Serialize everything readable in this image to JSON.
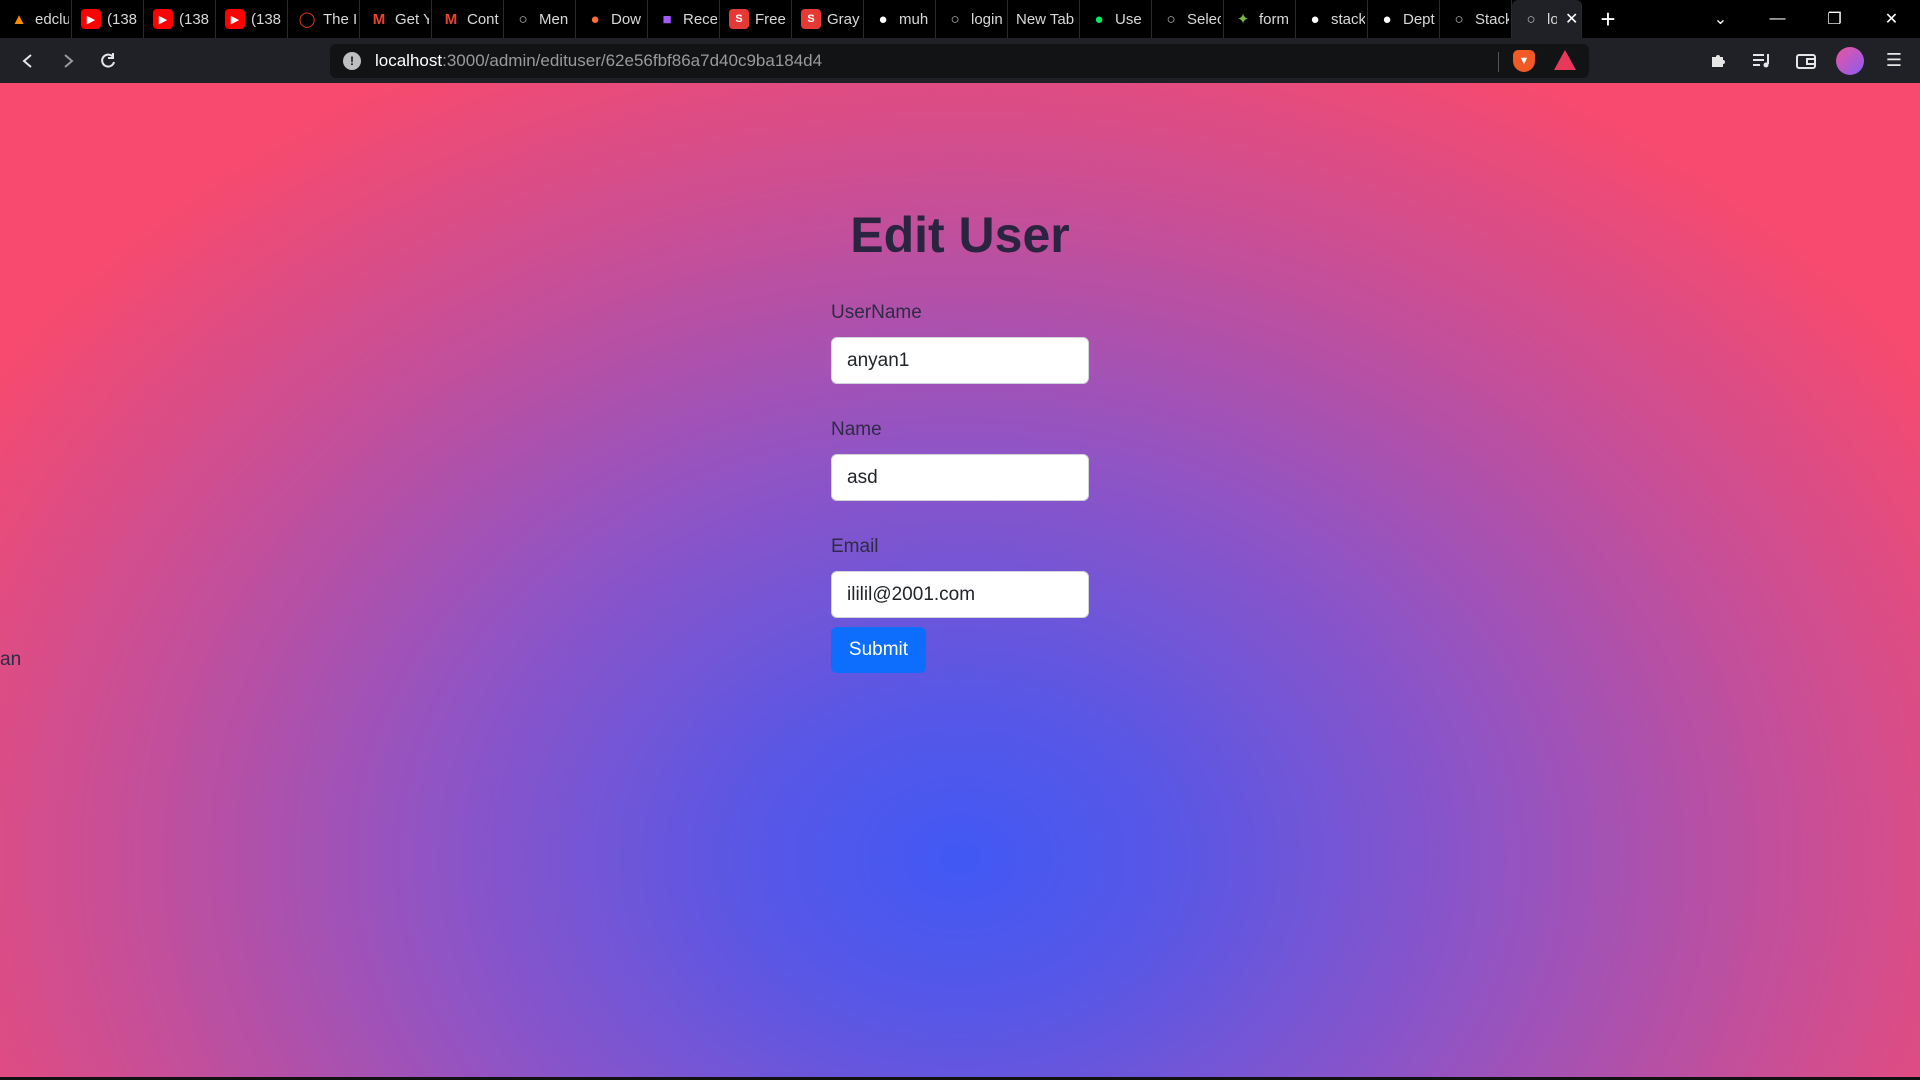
{
  "browser": {
    "tabs": [
      {
        "title": "edclu",
        "icon": "flame",
        "color": "#ff8a00"
      },
      {
        "title": "(138",
        "icon": "youtube",
        "color": "#ff0000"
      },
      {
        "title": "(138",
        "icon": "youtube",
        "color": "#ff0000"
      },
      {
        "title": "(138",
        "icon": "youtube",
        "color": "#ff0000"
      },
      {
        "title": "The I",
        "icon": "ring",
        "color": "#e8392b"
      },
      {
        "title": "Get Y",
        "icon": "gmail",
        "color": "#ea4335"
      },
      {
        "title": "Cont",
        "icon": "gmail",
        "color": "#ea4335"
      },
      {
        "title": "Men",
        "icon": "globe",
        "color": "#bdbdbd"
      },
      {
        "title": "Dow",
        "icon": "firefox",
        "color": "#ff7139"
      },
      {
        "title": "Rece",
        "icon": "figma",
        "color": "#a259ff"
      },
      {
        "title": "Free",
        "icon": "s",
        "color": "#e53935"
      },
      {
        "title": "Gray",
        "icon": "s",
        "color": "#e53935"
      },
      {
        "title": "muh",
        "icon": "github",
        "color": "#ffffff"
      },
      {
        "title": "login",
        "icon": "globe",
        "color": "#bdbdbd"
      },
      {
        "title": "New Tab",
        "icon": "none",
        "color": "#000000"
      },
      {
        "title": "Use",
        "icon": "leaf",
        "color": "#00ed64"
      },
      {
        "title": "Selec",
        "icon": "globe",
        "color": "#bdbdbd"
      },
      {
        "title": "form",
        "icon": "sparkle",
        "color": "#7cb342"
      },
      {
        "title": "stack",
        "icon": "github",
        "color": "#ffffff"
      },
      {
        "title": "Dept",
        "icon": "github",
        "color": "#ffffff"
      },
      {
        "title": "Stack",
        "icon": "globe",
        "color": "#bdbdbd"
      },
      {
        "title": "lo",
        "icon": "globe",
        "color": "#bdbdbd",
        "active": true
      }
    ],
    "url_host": "localhost",
    "url_path": ":3000/admin/edituser/62e56fbf86a7d40c9ba184d4"
  },
  "page": {
    "title": "Edit User",
    "fields": {
      "username": {
        "label": "UserName",
        "value": "anyan1"
      },
      "name": {
        "label": "Name",
        "value": "asd"
      },
      "email": {
        "label": "Email",
        "value": "ililil@2001.com"
      }
    },
    "submit_label": "Submit",
    "stray_text": "an"
  },
  "colors": {
    "primary_button": "#0d6efd",
    "gradient_center": "#4158f4",
    "gradient_edge": "#f74a6e"
  }
}
